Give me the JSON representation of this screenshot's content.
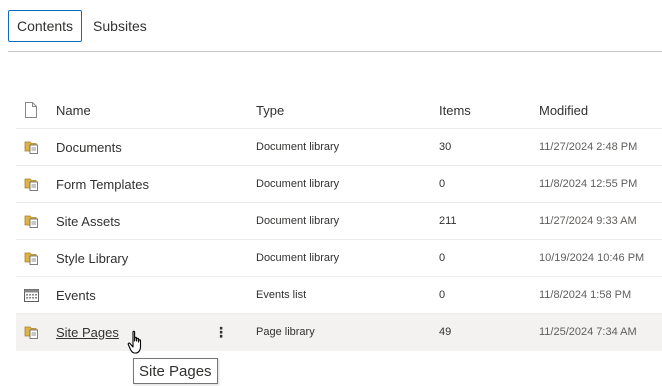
{
  "tabs": {
    "contents": "Contents",
    "subsites": "Subsites"
  },
  "table": {
    "headers": {
      "name": "Name",
      "type": "Type",
      "items": "Items",
      "modified": "Modified"
    },
    "rows": [
      {
        "name": "Documents",
        "type": "Document library",
        "items": "30",
        "modified": "11/27/2024 2:48 PM",
        "icon": "library-icon"
      },
      {
        "name": "Form Templates",
        "type": "Document library",
        "items": "0",
        "modified": "11/8/2024 12:55 PM",
        "icon": "library-icon"
      },
      {
        "name": "Site Assets",
        "type": "Document library",
        "items": "211",
        "modified": "11/27/2024 9:33 AM",
        "icon": "library-icon"
      },
      {
        "name": "Style Library",
        "type": "Document library",
        "items": "0",
        "modified": "10/19/2024 10:46 PM",
        "icon": "library-icon"
      },
      {
        "name": "Events",
        "type": "Events list",
        "items": "0",
        "modified": "11/8/2024 1:58 PM",
        "icon": "calendar-list-icon"
      },
      {
        "name": "Site Pages",
        "type": "Page library",
        "items": "49",
        "modified": "11/25/2024 7:34 AM",
        "icon": "library-icon",
        "more": "⋮"
      }
    ]
  },
  "tooltip": "Site Pages",
  "colors": {
    "accent": "#0f6cbd",
    "library_icon": "#c19c3c",
    "selected_row": "#f3f2f1"
  }
}
